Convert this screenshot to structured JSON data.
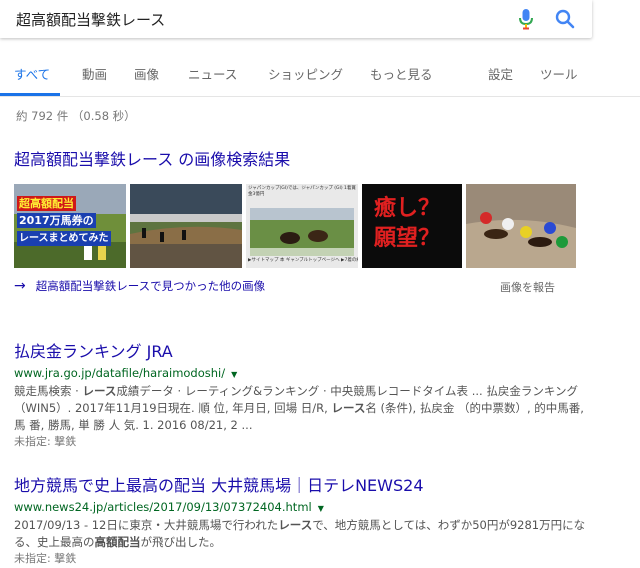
{
  "search": {
    "query": "超高額配当撃鉄レース"
  },
  "tabs": [
    {
      "label": "すべて"
    },
    {
      "label": "動画"
    },
    {
      "label": "画像"
    },
    {
      "label": "ニュース"
    },
    {
      "label": "ショッピング"
    },
    {
      "label": "もっと見る"
    },
    {
      "label": "設定"
    },
    {
      "label": "ツール"
    }
  ],
  "stats": "約 792 件 （0.58 秒）",
  "images": {
    "heading": "超高額配当撃鉄レース の画像検索結果",
    "thumb1_lines": [
      "超高額配当",
      "2017万馬券の",
      "レースまとめてみた"
    ],
    "thumb3_caption": "ジャパンカップ(GI)では、ジャパンカップ (GI) 1着賞金3億円",
    "thumb3_footer": "▶サイトマップ 本 ギャンブルトップページへ ▶7着の結果",
    "thumb4_lines": [
      "癒し？",
      "願望？"
    ],
    "more_link": "超高額配当撃鉄レースで見つかった他の画像",
    "report": "画像を報告"
  },
  "results": [
    {
      "title": "払戻金ランキング JRA",
      "url": "www.jra.go.jp/datafile/haraimodoshi/",
      "snippet": [
        {
          "t": "競走馬検索 · ",
          "b": false
        },
        {
          "t": "レース",
          "b": true
        },
        {
          "t": "成績データ · レーティング&ランキング · 中央競馬レコードタイム表 ... 払戻金ランキング（WIN5）. 2017年11月19日現在. 順 位, 年月日, 回場 日/R, ",
          "b": false
        },
        {
          "t": "レース",
          "b": true
        },
        {
          "t": "名 (条件), 払戻金 （的中票数）, 的中馬番, 馬 番, 勝馬, 単 勝 人 気. 1. 2016 08/21, 2 ...",
          "b": false
        }
      ],
      "missing_label": "未指定: ",
      "missing_term": "撃鉄"
    },
    {
      "title": "地方競馬で史上最高の配当 大井競馬場｜日テレNEWS24",
      "url": "www.news24.jp/articles/2017/09/13/07372404.html",
      "snippet": [
        {
          "t": "2017/09/13 - 12日に東京・大井競馬場で行われた",
          "b": false
        },
        {
          "t": "レース",
          "b": true
        },
        {
          "t": "で、地方競馬としては、わずか50円が9281万円になる、史上最高の",
          "b": false
        },
        {
          "t": "高額配当",
          "b": true
        },
        {
          "t": "が飛び出した。",
          "b": false
        }
      ],
      "missing_label": "未指定: ",
      "missing_term": "撃鉄"
    }
  ],
  "colors": {
    "link": "#1a0dab",
    "url": "#006621",
    "accent": "#1a73e8"
  }
}
